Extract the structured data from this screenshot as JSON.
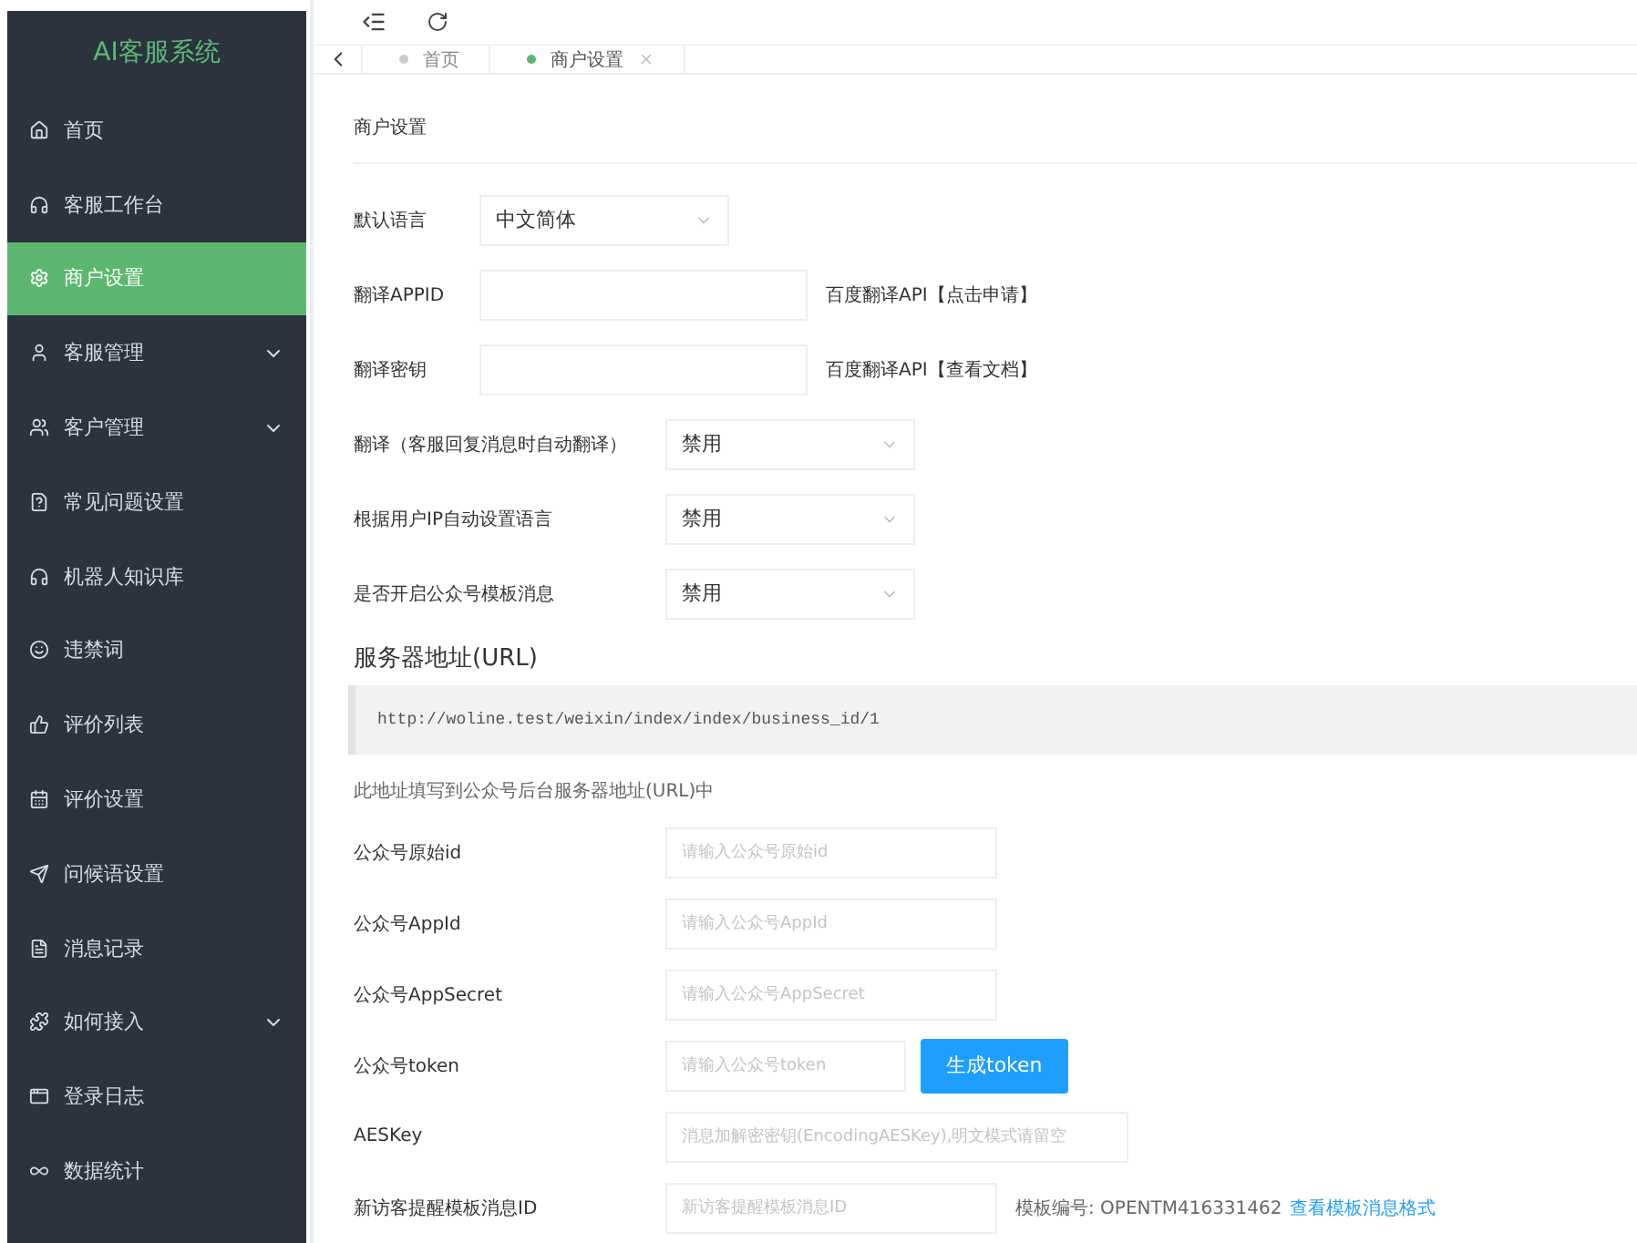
{
  "sidebar": {
    "title": "AI客服系统",
    "items": [
      {
        "label": "首页",
        "selected": false
      },
      {
        "label": "客服工作台",
        "selected": false
      },
      {
        "label": "商户设置",
        "selected": true
      },
      {
        "label": "客服管理",
        "selected": false,
        "expandable": true
      },
      {
        "label": "客户管理",
        "selected": false,
        "expandable": true
      },
      {
        "label": "常见问题设置",
        "selected": false
      },
      {
        "label": "机器人知识库",
        "selected": false
      },
      {
        "label": "违禁词",
        "selected": false
      },
      {
        "label": "评价列表",
        "selected": false
      },
      {
        "label": "评价设置",
        "selected": false
      },
      {
        "label": "问候语设置",
        "selected": false
      },
      {
        "label": "消息记录",
        "selected": false
      },
      {
        "label": "如何接入",
        "selected": false,
        "expandable": true
      },
      {
        "label": "登录日志",
        "selected": false
      },
      {
        "label": "数据统计",
        "selected": false
      }
    ]
  },
  "tabs": [
    {
      "label": "首页",
      "selected": false,
      "closable": false
    },
    {
      "label": "商户设置",
      "selected": true,
      "closable": true
    }
  ],
  "panel": {
    "title": "商户设置",
    "rows": [
      {
        "kind": "select",
        "label": "默认语言",
        "value": "中文简体"
      },
      {
        "kind": "input",
        "label": "翻译APPID",
        "suffix": "百度翻译API【点击申请】"
      },
      {
        "kind": "input",
        "label": "翻译密钥",
        "suffix": "百度翻译API【查看文档】"
      },
      {
        "kind": "select",
        "label": "翻译（客服回复消息时自动翻译）",
        "value": "禁用"
      },
      {
        "kind": "select",
        "label": "根据用户IP自动设置语言",
        "value": "禁用"
      },
      {
        "kind": "select",
        "label": "是否开启公众号模板消息",
        "value": "禁用"
      },
      {
        "kind": "heading",
        "label": "服务器地址(URL)"
      },
      {
        "kind": "code",
        "value": "http://woline.test/weixin/index/index/business_id/1"
      },
      {
        "kind": "hint",
        "label": "此地址填写到公众号后台服务器地址(URL)中"
      },
      {
        "kind": "field",
        "label": "公众号原始id",
        "placeholder": "请输入公众号原始id"
      },
      {
        "kind": "field",
        "label": "公众号AppId",
        "placeholder": "请输入公众号AppId"
      },
      {
        "kind": "field",
        "label": "公众号AppSecret",
        "placeholder": "请输入公众号AppSecret"
      },
      {
        "kind": "field",
        "label": "公众号token",
        "placeholder": "请输入公众号token",
        "button": "生成token"
      },
      {
        "kind": "field",
        "label": "AESKey",
        "placeholder": "消息加解密密钥(EncodingAESKey),明文模式请留空"
      },
      {
        "kind": "field",
        "label": "新访客提醒模板消息ID",
        "placeholder": "新访客提醒模板消息ID",
        "note": "模板编号: OPENTM416331462",
        "link": "查看模板消息格式"
      }
    ]
  }
}
